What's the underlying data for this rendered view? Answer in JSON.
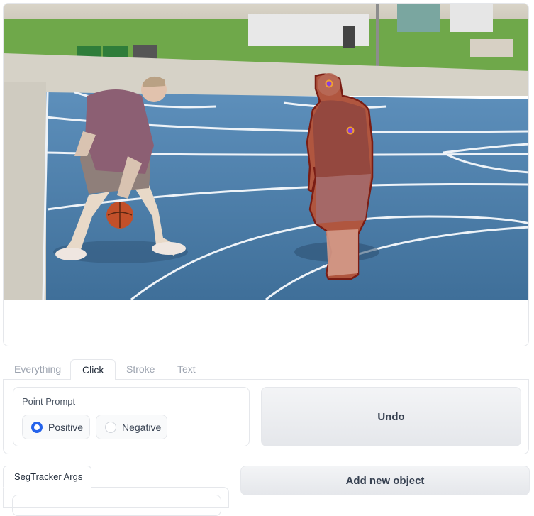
{
  "tabs": [
    {
      "label": "Everything",
      "active": false
    },
    {
      "label": "Click",
      "active": true
    },
    {
      "label": "Stroke",
      "active": false
    },
    {
      "label": "Text",
      "active": false
    }
  ],
  "click_panel": {
    "point_prompt": {
      "label": "Point Prompt",
      "options": [
        "Positive",
        "Negative"
      ],
      "selected": "Positive"
    },
    "undo_label": "Undo"
  },
  "segtracker": {
    "tab_label": "SegTracker Args"
  },
  "add_object_label": "Add new object",
  "colors": {
    "accent": "#2563eb",
    "mask": "#c0392b",
    "court": "#4a7fae",
    "click_point": "#8b3fd9"
  }
}
